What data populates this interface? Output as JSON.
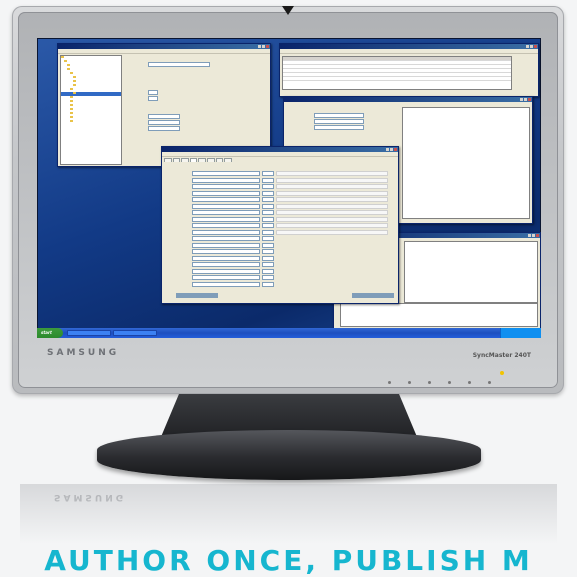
{
  "monitor": {
    "brand_left": "SAMSUNG",
    "brand_right": "SyncMaster 240T",
    "reflection_brand": "SAMSUNG"
  },
  "tagline": "AUTHOR ONCE, PUBLISH M",
  "colors": {
    "tagline": "#16b6cf",
    "desktop": "#123a86",
    "window_title": "#0a246a",
    "taskbar": "#245edb",
    "start_button": "#3c9b3c"
  },
  "screen": {
    "start_label": "start"
  }
}
